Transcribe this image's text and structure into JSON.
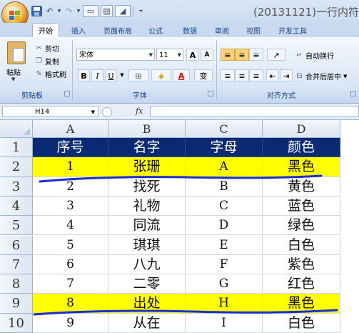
{
  "window": {
    "title": "(20131121)一行内符"
  },
  "quick_access": {
    "icons": [
      "save-icon",
      "undo-icon",
      "redo-icon",
      "form-icon",
      "table-icon",
      "erase-icon",
      "dropdown-icon"
    ]
  },
  "ribbon_tabs": [
    "开始",
    "插入",
    "页面布局",
    "公式",
    "数据",
    "审阅",
    "视图",
    "开发工具"
  ],
  "clipboard": {
    "paste": "粘贴",
    "cut": "剪切",
    "copy": "复制",
    "format_painter": "格式刷",
    "group_label": "剪贴板"
  },
  "font": {
    "name": "宋体",
    "size": "11",
    "grow": "A",
    "shrink": "A",
    "bold": "B",
    "italic": "I",
    "underline": "U",
    "font_color": "A",
    "phonetic": "变",
    "group_label": "字体"
  },
  "alignment": {
    "wrap_text": "自动换行",
    "merge_center": "合并后居中",
    "group_label": "对齐方式"
  },
  "formula_bar": {
    "name_box": "H14",
    "fx": "fx",
    "formula": ""
  },
  "columns": [
    "A",
    "B",
    "C",
    "D"
  ],
  "rows": [
    {
      "num": "1",
      "cells": [
        "序号",
        "名字",
        "字母",
        "颜色"
      ],
      "style": "head"
    },
    {
      "num": "2",
      "cells": [
        "1",
        "张珊",
        "A",
        "黑色"
      ],
      "style": "yellow"
    },
    {
      "num": "3",
      "cells": [
        "2",
        "找死",
        "B",
        "黄色"
      ],
      "style": "normal"
    },
    {
      "num": "4",
      "cells": [
        "3",
        "礼物",
        "C",
        "蓝色"
      ],
      "style": "normal"
    },
    {
      "num": "5",
      "cells": [
        "4",
        "同流",
        "D",
        "绿色"
      ],
      "style": "normal"
    },
    {
      "num": "6",
      "cells": [
        "5",
        "琪琪",
        "E",
        "白色"
      ],
      "style": "normal"
    },
    {
      "num": "7",
      "cells": [
        "6",
        "八九",
        "F",
        "紫色"
      ],
      "style": "normal"
    },
    {
      "num": "8",
      "cells": [
        "7",
        "二零",
        "G",
        "红色"
      ],
      "style": "normal"
    },
    {
      "num": "9",
      "cells": [
        "8",
        "出处",
        "H",
        "黑色"
      ],
      "style": "yellow"
    },
    {
      "num": "10",
      "cells": [
        "9",
        "从在",
        "I",
        "白色"
      ],
      "style": "normal"
    }
  ],
  "colors": {
    "header_fill": "#0a2a73",
    "highlight": "#ffff00",
    "marker": "#1a2fd0"
  }
}
